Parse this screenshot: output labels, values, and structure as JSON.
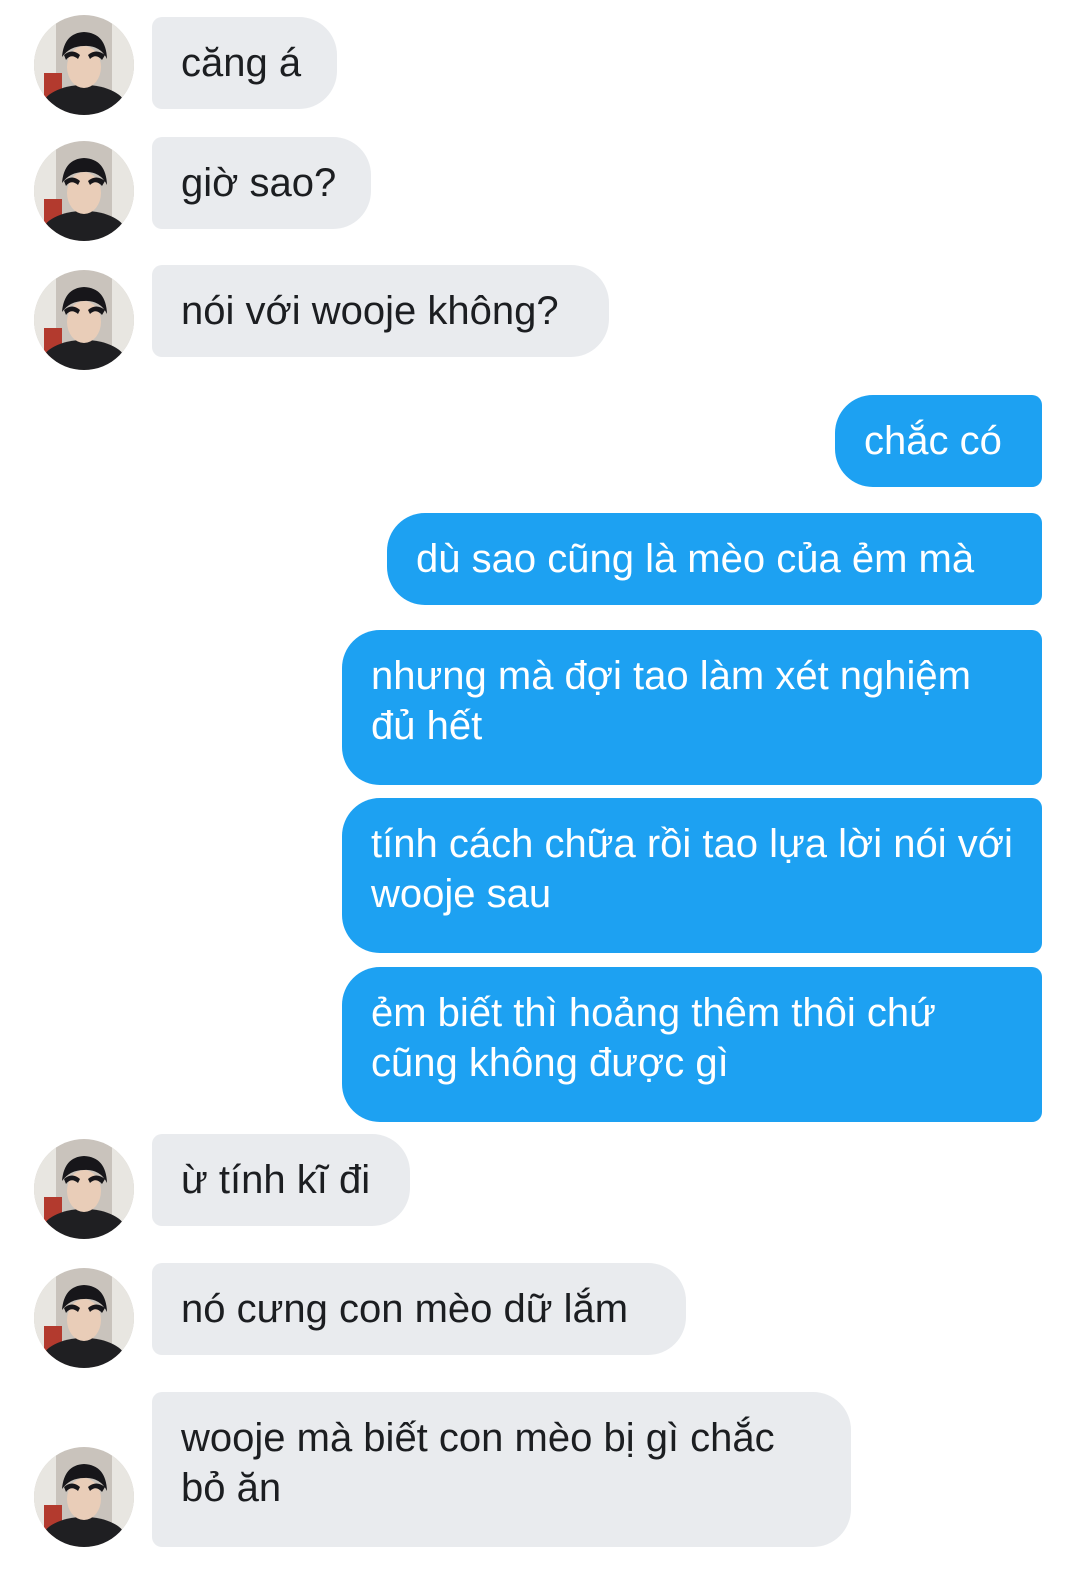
{
  "conversation": {
    "messages": [
      {
        "from": "contact",
        "text": "căng á"
      },
      {
        "from": "contact",
        "text": "giờ sao?"
      },
      {
        "from": "contact",
        "text": "nói với wooje không?"
      },
      {
        "from": "me",
        "text": "chắc có"
      },
      {
        "from": "me",
        "text": "dù sao cũng là mèo của ẻm mà"
      },
      {
        "from": "me",
        "text": "nhưng mà đợi tao làm xét nghiệm đủ hết"
      },
      {
        "from": "me",
        "text": "tính cách chữa rồi tao lựa lời nói với wooje sau"
      },
      {
        "from": "me",
        "text": "ẻm biết thì hoảng thêm thôi chứ cũng không được gì"
      },
      {
        "from": "contact",
        "text": "ừ tính kĩ đi"
      },
      {
        "from": "contact",
        "text": "nó cưng con mèo dữ lắm"
      },
      {
        "from": "contact",
        "text": "wooje mà biết con mèo bị gì chắc bỏ ăn"
      }
    ]
  },
  "colors": {
    "incoming_bubble": "#e9ebee",
    "outgoing_bubble": "#1da1f2",
    "incoming_text": "#1c1e21",
    "outgoing_text": "#ffffff"
  },
  "icons": {
    "avatar": "contact-avatar-photo"
  }
}
